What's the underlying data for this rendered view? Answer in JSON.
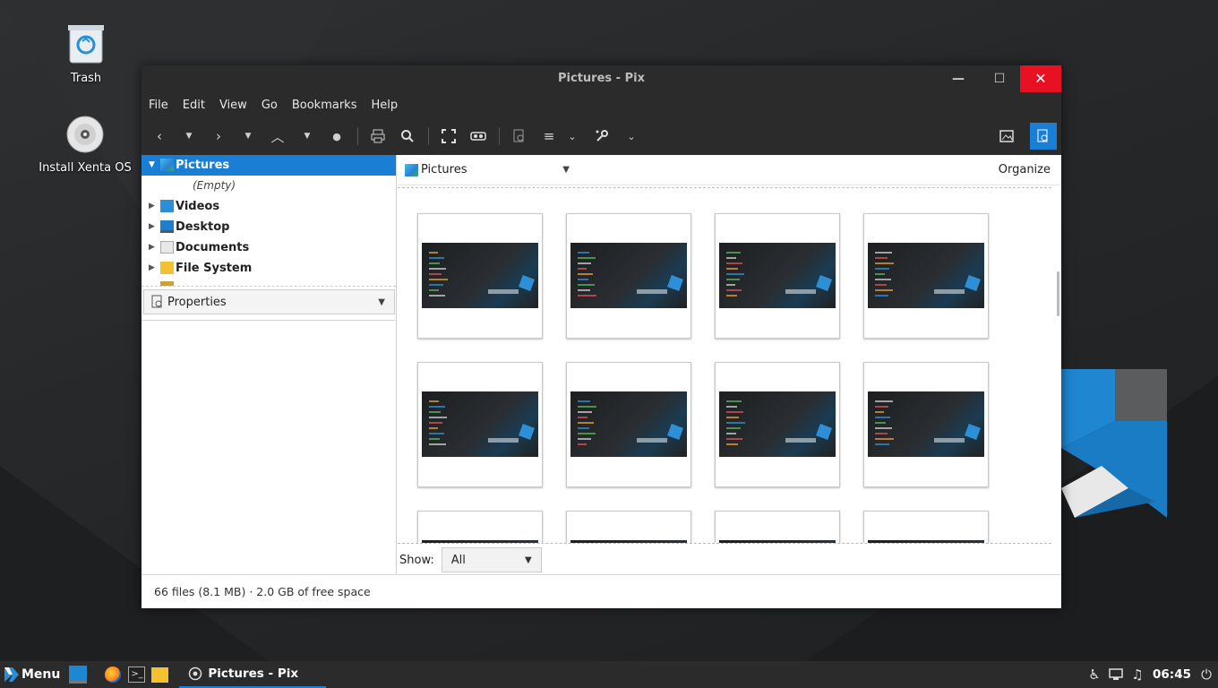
{
  "desktop": {
    "icons": [
      {
        "label": "Trash"
      },
      {
        "label": "Install Xenta OS"
      }
    ]
  },
  "window": {
    "title": "Pictures - Pix",
    "menu": [
      "File",
      "Edit",
      "View",
      "Go",
      "Bookmarks",
      "Help"
    ]
  },
  "sidebar": {
    "selected": "Pictures",
    "empty_label": "(Empty)",
    "items": [
      {
        "label": "Pictures"
      },
      {
        "label": "Videos"
      },
      {
        "label": "Desktop"
      },
      {
        "label": "Documents"
      },
      {
        "label": "File System"
      }
    ],
    "properties_label": "Properties"
  },
  "browser": {
    "location": "Pictures",
    "organize_label": "Organize",
    "show_label": "Show:",
    "show_value": "All",
    "thumbnail_rows_visible": 3,
    "thumbnail_columns": 4
  },
  "status": {
    "text": "66 files (8.1 MB) · 2.0 GB of free space"
  },
  "taskbar": {
    "menu_label": "Menu",
    "task_label": "Pictures - Pix",
    "clock": "06:45"
  },
  "colors": {
    "accent": "#1a7fd4",
    "close_button": "#e81123",
    "titlebar": "#2b2b2b"
  }
}
